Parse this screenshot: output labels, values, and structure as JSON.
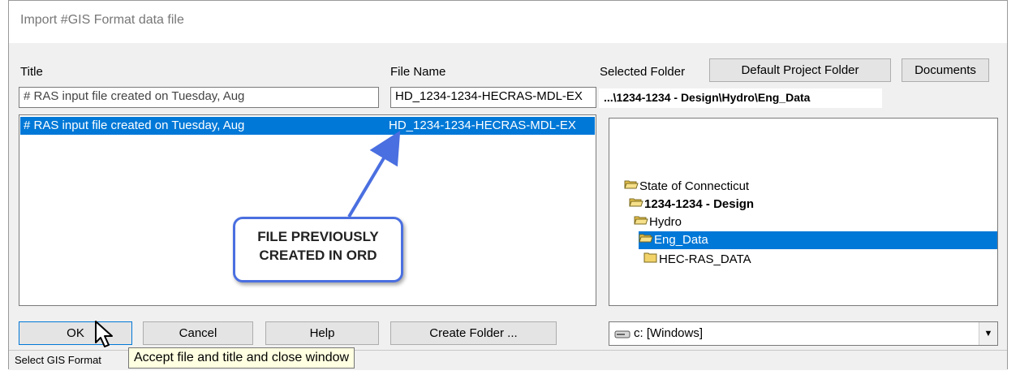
{
  "window": {
    "title": "Import #GIS Format data file"
  },
  "labels": {
    "title": "Title",
    "file_name": "File Name",
    "selected_folder": "Selected Folder"
  },
  "buttons": {
    "default_project_folder": "Default Project Folder",
    "documents": "Documents",
    "ok": "OK",
    "cancel": "Cancel",
    "help": "Help",
    "create_folder": "Create Folder ..."
  },
  "inputs": {
    "title_value": "# RAS input file created on Tuesday, Aug",
    "file_name_value": "HD_1234-1234-HECRAS-MDL-EX"
  },
  "selected_folder_path": "...\\1234-1234 - Design\\Hydro\\Eng_Data",
  "file_list": [
    {
      "title": "# RAS input file created on Tuesday, Aug",
      "file_name": "HD_1234-1234-HECRAS-MDL-EX",
      "selected": true
    }
  ],
  "folder_tree": [
    {
      "label": "State of Connecticut",
      "bold": false,
      "selected": false,
      "icon": "open-folder-icon"
    },
    {
      "label": "1234-1234 - Design",
      "bold": true,
      "selected": false,
      "icon": "open-folder-icon"
    },
    {
      "label": "Hydro",
      "bold": false,
      "selected": false,
      "icon": "open-folder-icon"
    },
    {
      "label": "Eng_Data",
      "bold": false,
      "selected": true,
      "icon": "open-folder-icon"
    },
    {
      "label": "HEC-RAS_DATA",
      "bold": false,
      "selected": false,
      "icon": "closed-folder-icon"
    }
  ],
  "drive": {
    "value": "c: [Windows]",
    "icon": "drive-icon"
  },
  "status": {
    "text": "Select GIS Format"
  },
  "tooltip": {
    "text": "Accept file and title and close window"
  },
  "callout": {
    "line1": "FILE PREVIOUSLY",
    "line2": "CREATED IN ORD"
  },
  "colors": {
    "selection": "#0078d7",
    "callout_border": "#4a6fe0",
    "tooltip_bg": "#ffffe1",
    "folder_yellow": "#f5d77a"
  }
}
